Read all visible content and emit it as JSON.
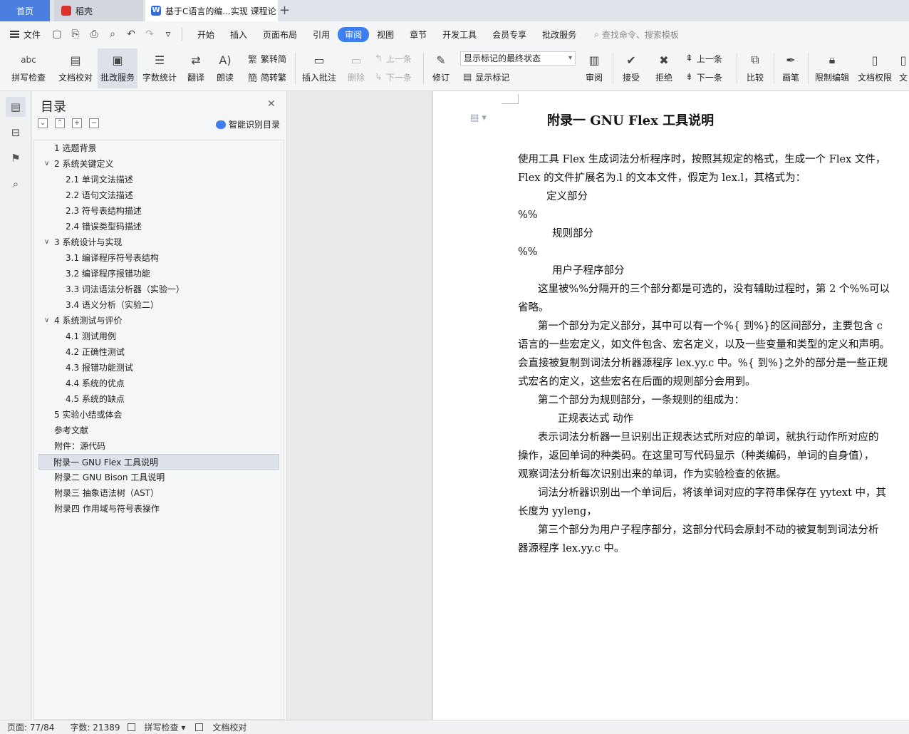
{
  "tabs": {
    "home": "首页",
    "daoke": "稻壳",
    "doc": "基于C语言的编...实现 课程论",
    "add": "+"
  },
  "menubar": {
    "file": "文件",
    "items": [
      "开始",
      "插入",
      "页面布局",
      "引用",
      "审阅",
      "视图",
      "章节",
      "开发工具",
      "会员专享",
      "批改服务"
    ],
    "active": "审阅",
    "search_placeholder": "查找命令、搜索模板"
  },
  "ribbon": {
    "spellcheck": "拼写检查",
    "doc_check": "文档校对",
    "grading": "批改服务",
    "word_count": "字数统计",
    "translate": "翻译",
    "read_aloud": "朗读",
    "trad_to_simp": "繁转简",
    "simp_to_trad": "简转繁",
    "insert_comment": "插入批注",
    "delete": "删除",
    "prev": "上一条",
    "next": "下一条",
    "revise": "修订",
    "markup_state": "显示标记的最终状态",
    "show_markup": "显示标记",
    "review": "审阅",
    "accept": "接受",
    "reject": "拒绝",
    "prev2": "上一条",
    "next2": "下一条",
    "compare": "比较",
    "pen": "画笔",
    "restrict_edit": "限制编辑",
    "doc_perm": "文档权限",
    "more": "文"
  },
  "toc": {
    "title": "目录",
    "smart": "智能识别目录",
    "items": [
      {
        "label": "1 选题背景",
        "level": 1,
        "chev": ""
      },
      {
        "label": "2 系统关键定义",
        "level": 1,
        "chev": "∨"
      },
      {
        "label": "2.1 单词文法描述",
        "level": 2,
        "chev": ""
      },
      {
        "label": "2.2 语句文法描述",
        "level": 2,
        "chev": ""
      },
      {
        "label": "2.3  符号表结构描述",
        "level": 2,
        "chev": ""
      },
      {
        "label": "2.4  错误类型码描述",
        "level": 2,
        "chev": ""
      },
      {
        "label": "3 系统设计与实现",
        "level": 1,
        "chev": "∨"
      },
      {
        "label": "3.1 编译程序符号表结构",
        "level": 2,
        "chev": ""
      },
      {
        "label": "3.2 编译程序报错功能",
        "level": 2,
        "chev": ""
      },
      {
        "label": "3.3 词法语法分析器（实验一）",
        "level": 2,
        "chev": ""
      },
      {
        "label": "3.4 语义分析（实验二）",
        "level": 2,
        "chev": ""
      },
      {
        "label": "4 系统测试与评价",
        "level": 1,
        "chev": "∨"
      },
      {
        "label": "4.1  测试用例",
        "level": 2,
        "chev": ""
      },
      {
        "label": "4.2  正确性测试",
        "level": 2,
        "chev": ""
      },
      {
        "label": "4.3  报错功能测试",
        "level": 2,
        "chev": ""
      },
      {
        "label": "4.4  系统的优点",
        "level": 2,
        "chev": ""
      },
      {
        "label": "4.5  系统的缺点",
        "level": 2,
        "chev": ""
      },
      {
        "label": "5 实验小结或体会",
        "level": 1,
        "chev": ""
      },
      {
        "label": "参考文献",
        "level": 1,
        "chev": ""
      },
      {
        "label": "附件：源代码",
        "level": 1,
        "chev": ""
      },
      {
        "label": "附录一  GNU Flex  工具说明",
        "level": 1,
        "chev": "",
        "active": true
      },
      {
        "label": "附录二  GNU Bison  工具说明",
        "level": 1,
        "chev": ""
      },
      {
        "label": "附录三  抽象语法树（AST）",
        "level": 1,
        "chev": ""
      },
      {
        "label": "附录四  作用域与符号表操作",
        "level": 1,
        "chev": ""
      }
    ]
  },
  "document": {
    "title": "附录一  GNU Flex  工具说明",
    "lines": [
      {
        "text": "使用工具 Flex 生成词法分析程序时，按照其规定的格式，生成一个 Flex 文件，",
        "indent": 0
      },
      {
        "text": "Flex 的文件扩展名为.l 的文本文件，假定为 lex.l，其格式为：",
        "indent": 0
      },
      {
        "text": "定义部分",
        "indent": 2
      },
      {
        "text": "%%",
        "indent": 0
      },
      {
        "text": "规则部分",
        "indent": 3
      },
      {
        "text": "%%",
        "indent": 0
      },
      {
        "text": "用户子程序部分",
        "indent": 3
      },
      {
        "text": "这里被%%分隔开的三个部分都是可选的，没有辅助过程时，第 2 个%%可以",
        "indent": 1
      },
      {
        "text": "省略。",
        "indent": 0
      },
      {
        "text": "第一个部分为定义部分，其中可以有一个%{  到%}的区间部分，主要包含 c",
        "indent": 1
      },
      {
        "text": "语言的一些宏定义，如文件包含、宏名定义，以及一些变量和类型的定义和声明。",
        "indent": 0
      },
      {
        "text": "会直接被复制到词法分析器源程序 lex.yy.c 中。%{  到%}之外的部分是一些正规",
        "indent": 0
      },
      {
        "text": "式宏名的定义，这些宏名在后面的规则部分会用到。",
        "indent": 0
      },
      {
        "text": "第二个部分为规则部分，一条规则的组成为：",
        "indent": 1
      },
      {
        "text": "正规表达式       动作",
        "indent": 4
      },
      {
        "text": "表示词法分析器一旦识别出正规表达式所对应的单词，就执行动作所对应的",
        "indent": 1
      },
      {
        "text": "操作，返回单词的种类码。在这里可写代码显示（种类编码，单词的自身值），",
        "indent": 0
      },
      {
        "text": "观察词法分析每次识别出来的单词，作为实验检查的依据。",
        "indent": 0
      },
      {
        "text": "词法分析器识别出一个单词后，将该单词对应的字符串保存在 yytext 中，其",
        "indent": 1
      },
      {
        "text": "长度为 yyleng，",
        "indent": 0
      },
      {
        "text": "第三个部分为用户子程序部分，这部分代码会原封不动的被复制到词法分析",
        "indent": 1
      },
      {
        "text": "器源程序 lex.yy.c 中。",
        "indent": 0
      }
    ]
  },
  "status": {
    "page": "页面: 77/84",
    "words": "字数: 21389",
    "spell": "拼写检查",
    "proof": "文档校对"
  }
}
